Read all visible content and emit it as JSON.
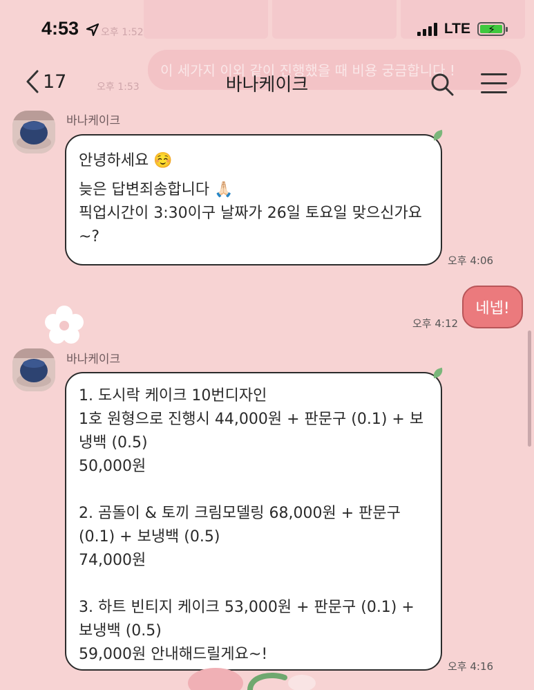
{
  "status_bar": {
    "time": "4:53",
    "network": "LTE"
  },
  "background_ghost": {
    "text": "이 세가지 이외 같이 진행했을 때 비용 궁금합니다 !",
    "time_1": "오후 1:52",
    "time_2": "오후 1:53"
  },
  "header": {
    "back_count": "17",
    "title": "바나케이크"
  },
  "messages": [
    {
      "sender": "바나케이크",
      "lines": [
        "안녕하세요 ☺️",
        "늦은 답변죄송합니다 🙏🏻",
        "픽업시간이 3:30이구 날짜가 26일 토요일 맞으신가요~?"
      ],
      "time": "오후 4:06"
    },
    {
      "mine": true,
      "text": "네넵!",
      "time": "오후 4:12"
    },
    {
      "sender": "바나케이크",
      "lines": [
        "1. 도시락 케이크 10번디자인",
        "1호 원형으로 진행시 44,000원 + 판문구 (0.1) + 보냉백 (0.5)",
        "50,000원",
        "",
        "2. 곰돌이 & 토끼 크림모델링 68,000원 + 판문구 (0.1) + 보냉백 (0.5)",
        "74,000원",
        "",
        "3. 하트 빈티지 케이크 53,000원  + 판문구 (0.1) + 보냉백 (0.5)",
        "59,000원 안내해드릴게요~!"
      ],
      "time": "오후 4:16"
    }
  ],
  "colors": {
    "background": "#f7d3d3",
    "my_bubble": "#eb7a7d",
    "accent_leaf": "#7ab67a"
  },
  "icons": [
    "location-arrow-icon",
    "signal-icon",
    "battery-charging-icon",
    "back-chevron-icon",
    "search-icon",
    "menu-icon",
    "flower-icon"
  ]
}
